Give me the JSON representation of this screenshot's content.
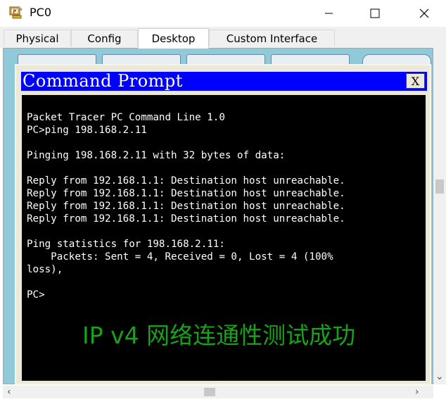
{
  "window": {
    "title": "PC0",
    "icon": "packet-tracer-pc-icon",
    "controls": [
      "minimize-icon",
      "maximize-icon",
      "close-icon"
    ]
  },
  "tabs": [
    {
      "label": "Physical",
      "active": false
    },
    {
      "label": "Config",
      "active": false
    },
    {
      "label": "Desktop",
      "active": true
    },
    {
      "label": "Custom Interface",
      "active": false
    }
  ],
  "command_prompt": {
    "title": "Command Prompt",
    "close_label": "X",
    "lines": [
      "Packet Tracer PC Command Line 1.0",
      "PC>ping 198.168.2.11",
      "",
      "Pinging 198.168.2.11 with 32 bytes of data:",
      "",
      "Reply from 192.168.1.1: Destination host unreachable.",
      "Reply from 192.168.1.1: Destination host unreachable.",
      "Reply from 192.168.1.1: Destination host unreachable.",
      "Reply from 192.168.1.1: Destination host unreachable.",
      "",
      "Ping statistics for 198.168.2.11:",
      "    Packets: Sent = 4, Received = 0, Lost = 4 (100%",
      "loss),",
      "",
      "PC>"
    ]
  },
  "overlay": {
    "text": "IP v4 网络连通性测试成功",
    "color": "#1aa11a"
  },
  "colors": {
    "titlebar_blue": "#0000ff",
    "console_bg": "#000000",
    "console_fg": "#ffffff",
    "desktop_bg": "#8fc9da"
  }
}
